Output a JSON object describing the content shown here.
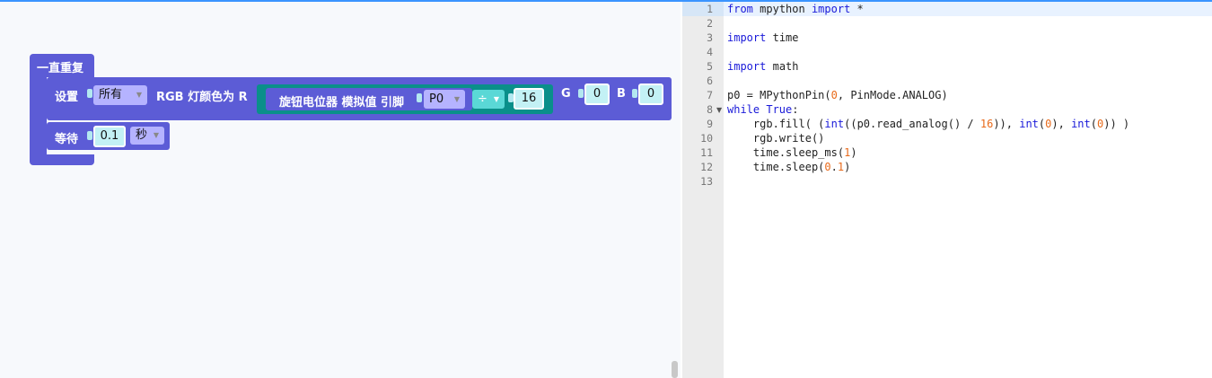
{
  "workspace": {
    "loop_label": "一直重复",
    "set_block": {
      "set_label": "设置",
      "target_dropdown": "所有",
      "rgb_label": "RGB 灯颜色为 R",
      "sensor_label": "旋钮电位器 模拟值 引脚",
      "pin_dropdown": "P0",
      "op_dropdown": "÷",
      "divisor_value": "16",
      "g_label": "G",
      "g_value": "0",
      "b_label": "B",
      "b_value": "0"
    },
    "wait_block": {
      "wait_label": "等待",
      "seconds_value": "0.1",
      "unit_dropdown": "秒"
    }
  },
  "code_editor": {
    "active_line": 1,
    "lines": [
      {
        "n": "1",
        "text": "from mpython import *"
      },
      {
        "n": "2",
        "text": ""
      },
      {
        "n": "3",
        "text": "import time"
      },
      {
        "n": "4",
        "text": ""
      },
      {
        "n": "5",
        "text": "import math"
      },
      {
        "n": "6",
        "text": ""
      },
      {
        "n": "7",
        "text": "p0 = MPythonPin(0, PinMode.ANALOG)"
      },
      {
        "n": "8",
        "text": "while True:"
      },
      {
        "n": "9",
        "text": "    rgb.fill( (int((p0.read_analog() / 16)), int(0), int(0)) )"
      },
      {
        "n": "10",
        "text": "    rgb.write()"
      },
      {
        "n": "11",
        "text": "    time.sleep_ms(1)"
      },
      {
        "n": "12",
        "text": "    time.sleep(0.1)"
      },
      {
        "n": "13",
        "text": ""
      }
    ]
  },
  "colors": {
    "block_purple": "#5c5cd6",
    "sensor_teal": "#0a8f8a",
    "keyword_blue": "#1a1ad9",
    "number_orange": "#e86a1a"
  }
}
